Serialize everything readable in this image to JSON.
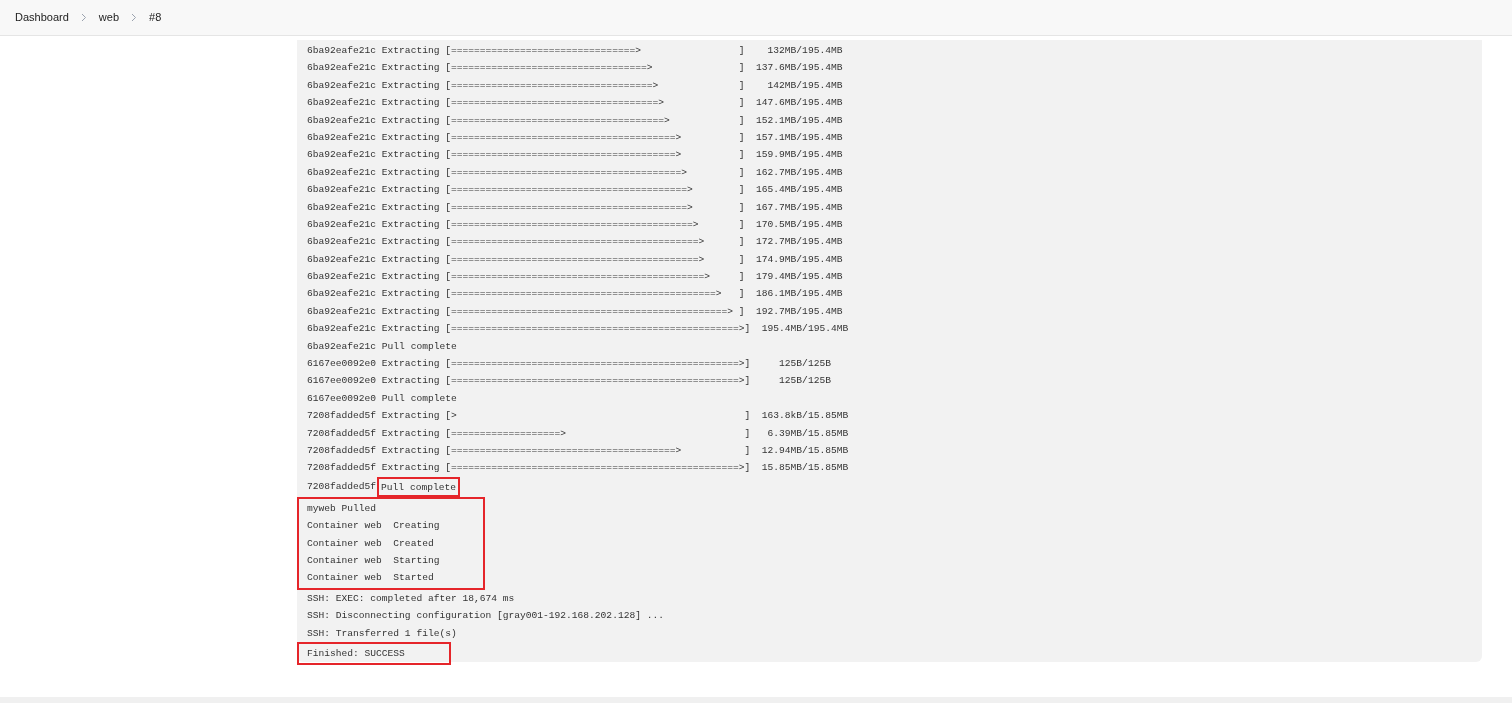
{
  "breadcrumbs": [
    {
      "label": "Dashboard"
    },
    {
      "label": "web"
    },
    {
      "label": "#8"
    }
  ],
  "console": {
    "groups": [
      {
        "boxed": false,
        "lines": [
          "6ba92eafe21c Extracting [================================>                 ]    132MB/195.4MB",
          "6ba92eafe21c Extracting [==================================>               ]  137.6MB/195.4MB",
          "6ba92eafe21c Extracting [===================================>              ]    142MB/195.4MB",
          "6ba92eafe21c Extracting [====================================>             ]  147.6MB/195.4MB",
          "6ba92eafe21c Extracting [=====================================>            ]  152.1MB/195.4MB",
          "6ba92eafe21c Extracting [=======================================>          ]  157.1MB/195.4MB",
          "6ba92eafe21c Extracting [=======================================>          ]  159.9MB/195.4MB",
          "6ba92eafe21c Extracting [========================================>         ]  162.7MB/195.4MB",
          "6ba92eafe21c Extracting [=========================================>        ]  165.4MB/195.4MB",
          "6ba92eafe21c Extracting [=========================================>        ]  167.7MB/195.4MB",
          "6ba92eafe21c Extracting [==========================================>       ]  170.5MB/195.4MB",
          "6ba92eafe21c Extracting [===========================================>      ]  172.7MB/195.4MB",
          "6ba92eafe21c Extracting [===========================================>      ]  174.9MB/195.4MB",
          "6ba92eafe21c Extracting [============================================>     ]  179.4MB/195.4MB",
          "6ba92eafe21c Extracting [==============================================>   ]  186.1MB/195.4MB",
          "6ba92eafe21c Extracting [================================================> ]  192.7MB/195.4MB",
          "6ba92eafe21c Extracting [==================================================>]  195.4MB/195.4MB",
          "6ba92eafe21c Pull complete",
          "6167ee0092e0 Extracting [==================================================>]     125B/125B",
          "6167ee0092e0 Extracting [==================================================>]     125B/125B",
          "6167ee0092e0 Pull complete",
          "7208fadded5f Extracting [>                                                  ]  163.8kB/15.85MB",
          "7208fadded5f Extracting [===================>                               ]   6.39MB/15.85MB",
          "7208fadded5f Extracting [=======================================>           ]  12.94MB/15.85MB",
          "7208fadded5f Extracting [==================================================>]  15.85MB/15.85MB"
        ]
      },
      {
        "boxed": false,
        "lines": [
          "7208fadded5f"
        ],
        "boxed_tail": "Pull complete"
      },
      {
        "boxed": true,
        "lines": [
          "myweb Pulled",
          "Container web  Creating",
          "Container web  Created",
          "Container web  Starting",
          "Container web  Started"
        ]
      },
      {
        "boxed": false,
        "lines": [
          "SSH: EXEC: completed after 18,674 ms",
          "SSH: Disconnecting configuration [gray001-192.168.202.128] ...",
          "SSH: Transferred 1 file(s)"
        ]
      },
      {
        "boxed": true,
        "lines": [
          "Finished: SUCCESS"
        ]
      }
    ]
  }
}
